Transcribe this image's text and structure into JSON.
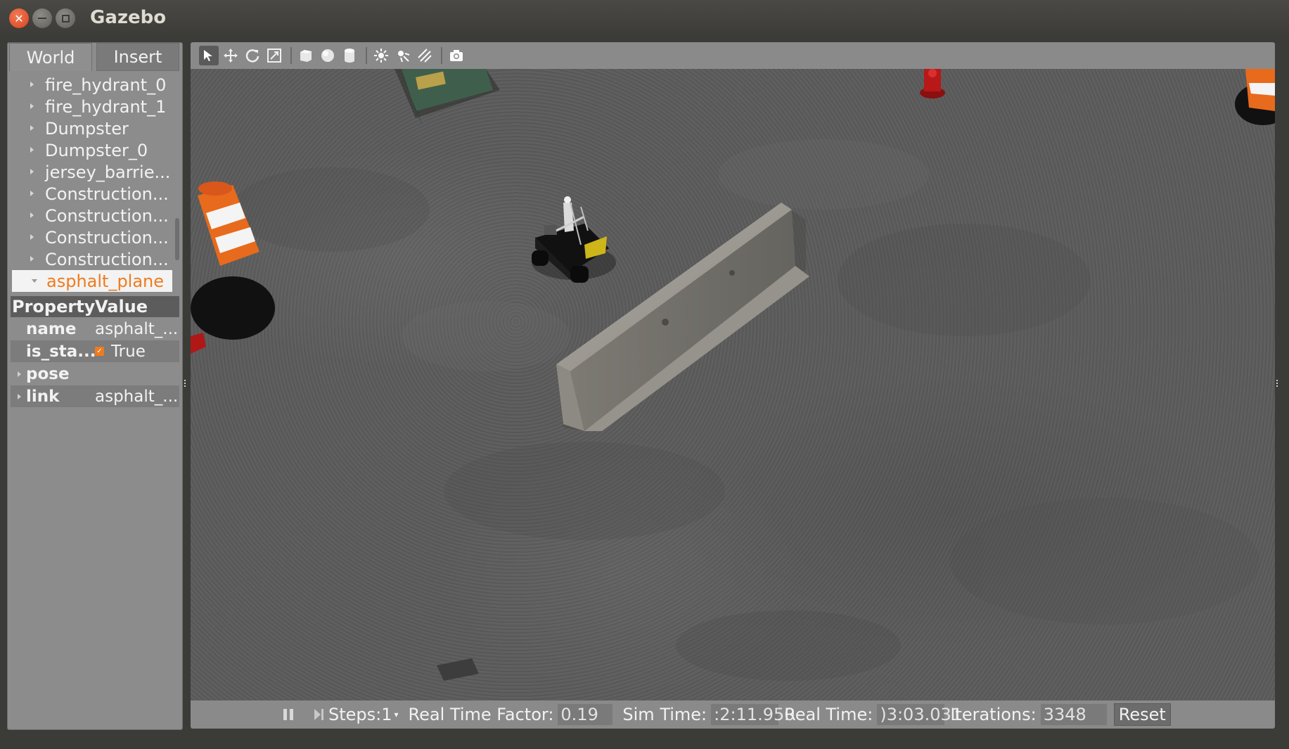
{
  "window": {
    "title": "Gazebo"
  },
  "left_panel": {
    "tabs": [
      {
        "label": "World"
      },
      {
        "label": "Insert"
      }
    ],
    "models": [
      {
        "label": "fire_hydrant_0"
      },
      {
        "label": "fire_hydrant_1"
      },
      {
        "label": "Dumpster"
      },
      {
        "label": "Dumpster_0"
      },
      {
        "label": "jersey_barrie..."
      },
      {
        "label": "Construction..."
      },
      {
        "label": "Construction..."
      },
      {
        "label": "Construction..."
      },
      {
        "label": "Construction..."
      },
      {
        "label": "asphalt_plane"
      }
    ],
    "selected_model": "asphalt_plane",
    "properties": {
      "header_property": "Property",
      "header_value": "Value",
      "rows": [
        {
          "name": "name",
          "value": "asphalt_..."
        },
        {
          "name": "is_sta...",
          "value": "True",
          "checked": true
        },
        {
          "name": "pose",
          "value": ""
        },
        {
          "name": "link",
          "value": "asphalt_..."
        }
      ]
    }
  },
  "toolbar": {
    "icons": [
      "select-arrow-icon",
      "translate-icon",
      "rotate-icon",
      "scale-icon",
      "box-icon",
      "sphere-icon",
      "cylinder-icon",
      "point-light-icon",
      "spot-light-icon",
      "directional-light-icon",
      "screenshot-camera-icon"
    ]
  },
  "statusbar": {
    "steps_label": "Steps:1",
    "real_time_factor_label": "Real Time Factor:",
    "real_time_factor_value": "0.19",
    "sim_time_label": "Sim Time:",
    "sim_time_value": ":2:11.950",
    "real_time_label": "Real Time:",
    "real_time_value": ")3:03.031",
    "iterations_label": "Iterations:",
    "iterations_value": "3348",
    "reset_label": "Reset"
  },
  "colors": {
    "accent_orange": "#f07b1e",
    "panel_gray": "#8c8c8c",
    "titlebar": "#3c3b37"
  }
}
